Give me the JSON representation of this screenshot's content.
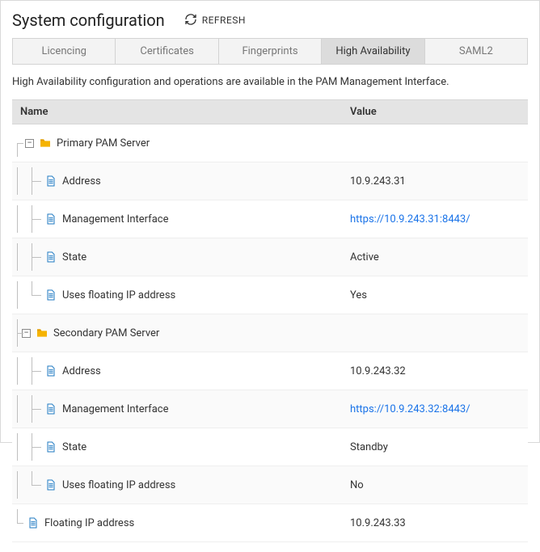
{
  "header": {
    "title": "System configuration",
    "refresh_label": "REFRESH"
  },
  "tabs": {
    "items": [
      {
        "label": "Licencing"
      },
      {
        "label": "Certificates"
      },
      {
        "label": "Fingerprints"
      },
      {
        "label": "High Availability"
      },
      {
        "label": "SAML2"
      }
    ],
    "active_index": 3
  },
  "description": "High Availability configuration and operations are available in the PAM Management Interface.",
  "grid": {
    "headers": {
      "name": "Name",
      "value": "Value"
    }
  },
  "tree": {
    "nodes": [
      {
        "label": "Primary PAM Server",
        "children": [
          {
            "label": "Address",
            "value": "10.9.243.31"
          },
          {
            "label": "Management Interface",
            "value": "https://10.9.243.31:8443/",
            "is_link": true
          },
          {
            "label": "State",
            "value": "Active"
          },
          {
            "label": "Uses floating IP address",
            "value": "Yes"
          }
        ]
      },
      {
        "label": "Secondary PAM Server",
        "children": [
          {
            "label": "Address",
            "value": "10.9.243.32"
          },
          {
            "label": "Management Interface",
            "value": "https://10.9.243.32:8443/",
            "is_link": true
          },
          {
            "label": "State",
            "value": "Standby"
          },
          {
            "label": "Uses floating IP address",
            "value": "No"
          }
        ]
      },
      {
        "label": "Floating IP address",
        "value": "10.9.243.33",
        "leaf": true
      }
    ]
  }
}
